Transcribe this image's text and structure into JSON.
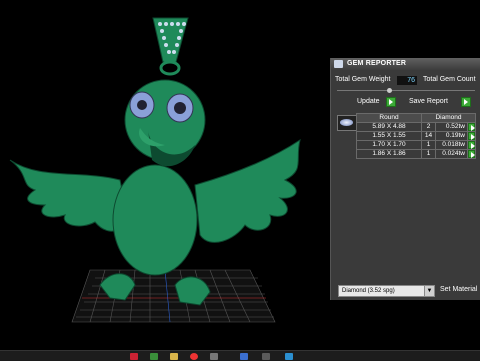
{
  "panel": {
    "title": "GEM REPORTER",
    "total_weight_label": "Total Gem Weight",
    "total_weight_value": "76",
    "total_count_label": "Total Gem Count",
    "update_label": "Update",
    "save_report_label": "Save Report",
    "table": {
      "header": [
        "Round",
        "Diamond"
      ],
      "rows": [
        {
          "size": "5.89 X 4.88",
          "count": "2",
          "weight": "0.52tw"
        },
        {
          "size": "1.55 X 1.55",
          "count": "14",
          "weight": "0.19tw"
        },
        {
          "size": "1.70 X 1.70",
          "count": "1",
          "weight": "0.018tw"
        },
        {
          "size": "1.86 X 1.86",
          "count": "1",
          "weight": "0.024tw"
        }
      ]
    },
    "material_select": "Diamond     (3.52 spg)",
    "set_material_label": "Set Material"
  },
  "viewport": {
    "model": "green parrot pendant 3D model on grid",
    "colors": {
      "model": "#1f8a5a",
      "grid_line": "#555",
      "axis_red": "#c33"
    }
  },
  "taskbar_icons": [
    "start",
    "folder",
    "browser",
    "media",
    "app",
    "app",
    "app"
  ]
}
